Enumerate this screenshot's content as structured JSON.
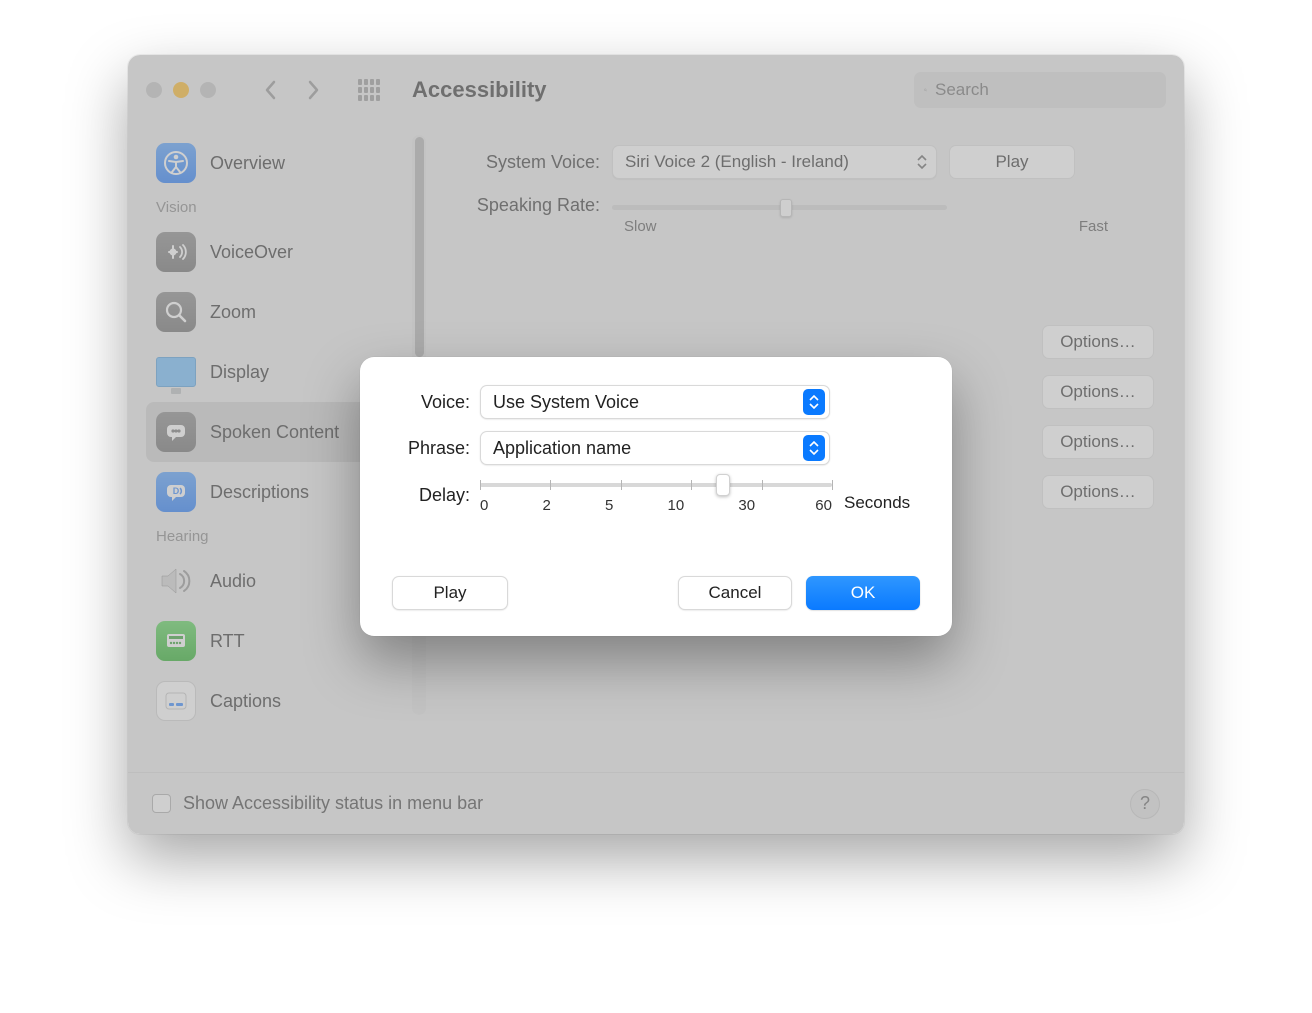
{
  "window": {
    "title": "Accessibility",
    "search_placeholder": "Search"
  },
  "sidebar": {
    "items": [
      {
        "label": "Overview"
      },
      {
        "section": "Vision"
      },
      {
        "label": "VoiceOver"
      },
      {
        "label": "Zoom"
      },
      {
        "label": "Display"
      },
      {
        "label": "Spoken Content",
        "selected": true
      },
      {
        "label": "Descriptions"
      },
      {
        "section": "Hearing"
      },
      {
        "label": "Audio"
      },
      {
        "label": "RTT"
      },
      {
        "label": "Captions"
      }
    ]
  },
  "content": {
    "system_voice_label": "System Voice:",
    "system_voice_value": "Siri Voice 2 (English - Ireland)",
    "play_label": "Play",
    "speaking_rate_label": "Speaking Rate:",
    "rate_slow": "Slow",
    "rate_fast": "Fast",
    "options_label": "Options…"
  },
  "footer": {
    "checkbox_label": "Show Accessibility status in menu bar",
    "help": "?"
  },
  "sheet": {
    "voice_label": "Voice:",
    "voice_value": "Use System Voice",
    "phrase_label": "Phrase:",
    "phrase_value": "Application name",
    "delay_label": "Delay:",
    "delay_ticks": [
      "0",
      "2",
      "5",
      "10",
      "30",
      "60"
    ],
    "delay_unit": "Seconds",
    "play": "Play",
    "cancel": "Cancel",
    "ok": "OK"
  }
}
